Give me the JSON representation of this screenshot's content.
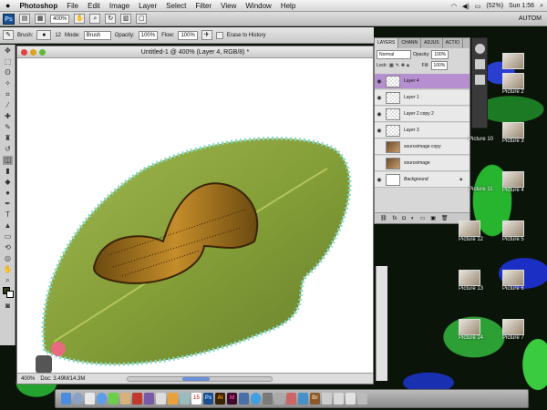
{
  "menubar": {
    "apple": "",
    "app": "Photoshop",
    "items": [
      "File",
      "Edit",
      "Image",
      "Layer",
      "Select",
      "Filter",
      "View",
      "Window",
      "Help"
    ],
    "battery": "(52%)",
    "clock": "Sun 1:56"
  },
  "appbar": {
    "ps": "Ps",
    "zoom": "400%",
    "autosave": "AUTOM"
  },
  "options": {
    "brush_label": "Brush:",
    "brush_size": "12",
    "mode_label": "Mode:",
    "mode": "Brush",
    "opacity_label": "Opacity:",
    "opacity": "100%",
    "flow_label": "Flow:",
    "flow": "100%",
    "erase_history": "Erase to History"
  },
  "document": {
    "title": "Untitled-1 @ 400% (Layer 4, RGB/8) *",
    "zoom": "400%",
    "doc_info": "Doc: 3.49M/14.3M"
  },
  "layers": {
    "tabs": [
      "LAYERS",
      "CHANN",
      "ADJUS",
      "ACTIO"
    ],
    "blend": "Normal",
    "opacity_label": "Opacity:",
    "opacity": "100%",
    "lock_label": "Lock:",
    "fill_label": "Fill:",
    "fill": "100%",
    "rows": [
      {
        "name": "Layer 4"
      },
      {
        "name": "Layer 1"
      },
      {
        "name": "Layer 2 copy 2"
      },
      {
        "name": "Layer 3"
      },
      {
        "name": "sourceimage copy"
      },
      {
        "name": "sourceimage"
      },
      {
        "name": "Background"
      }
    ]
  },
  "desktop": {
    "icons": [
      "Picture 1",
      "Picture 2",
      "Picture 3",
      "Picture 4",
      "Picture 5",
      "Picture 6",
      "Picture 7",
      "Picture 10",
      "Picture 11",
      "Picture 12",
      "Picture 13",
      "Picture 14"
    ]
  },
  "dock": {
    "calendar_day": "15",
    "apps": [
      "Ps",
      "Ai",
      "Id",
      "Br"
    ]
  }
}
